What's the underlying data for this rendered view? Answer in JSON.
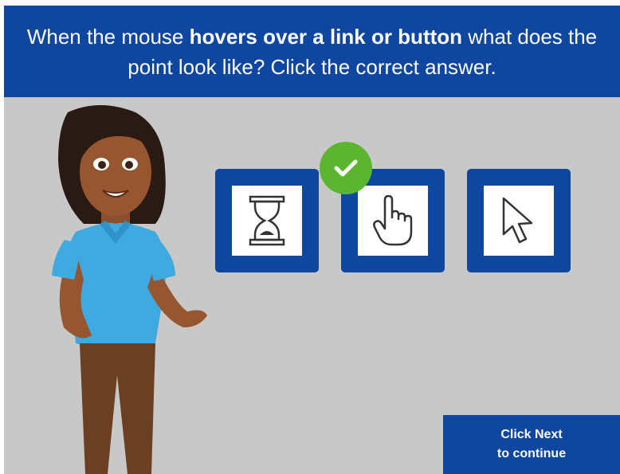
{
  "header": {
    "question_part1": "When the mouse ",
    "question_bold": "hovers over a link or button",
    "question_part2": " what does the point look like? Click the correct answer."
  },
  "options": [
    {
      "icon": "hourglass-icon",
      "selected": false
    },
    {
      "icon": "hand-pointer-icon",
      "selected": true
    },
    {
      "icon": "arrow-cursor-icon",
      "selected": false
    }
  ],
  "feedback": {
    "icon": "checkmark-icon",
    "color": "#5cb531"
  },
  "next_button": {
    "line1": "Click Next",
    "line2": "to continue"
  },
  "colors": {
    "brand_blue": "#0f46a0",
    "background": "#c8c8c8",
    "correct_green": "#5cb531"
  }
}
